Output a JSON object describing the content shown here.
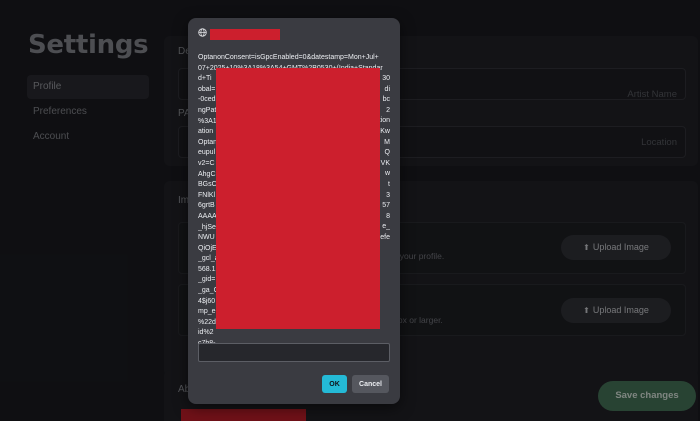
{
  "settings": {
    "title": "Settings",
    "nav": [
      "Profile",
      "Preferences",
      "Account"
    ]
  },
  "details_card": {
    "label": "De",
    "field1_placeholder": "Artist Name",
    "second_label": "PA",
    "field2_placeholder": "Location"
  },
  "images_card": {
    "label": "Im",
    "row1_hint": "ance your profile.",
    "row2_hint": "1200px or larger.",
    "upload_label": "Upload Image",
    "upload_icon": "upload-arrow-icon"
  },
  "about_card": {
    "label": "Ab"
  },
  "save_label": "Save changes",
  "colors": {
    "accent_ok": "#24bad6",
    "save": "#4a7a5e",
    "redaction": "#cc1f2d"
  },
  "modal": {
    "icon": "globe-icon",
    "lines": [
      "OptanonConsent=isGpcEnabled=0&datestamp=Mon+Jul+",
      "07+2025+10%3A18%3A54+GMT%2B0530+(India+Standar",
      "d+Ti",
      "obal=",
      "-0ced",
      "ngPat",
      "%3A1",
      "ation",
      "Optan",
      "eupul",
      "v2=C",
      "AhgC",
      "BGsC",
      "FNlKl",
      "6grtB",
      "AAAA",
      "_hjSe",
      "NWU",
      "QiOjE",
      "_gcl_a",
      "568.1",
      "_gid=",
      "_ga_C",
      "4$j60",
      "mp_e",
      "%22d",
      "id%2",
      "c7b8-",
      "rrer%22%3A%22%24direct%22%2C%22%24initial_referring"
    ],
    "right_fragments": [
      "30",
      "di",
      "bc",
      "2",
      "ocation",
      "Kw",
      "M",
      "Q",
      "VK",
      "w",
      "t",
      "3",
      "57",
      "8",
      "e_",
      "efe"
    ],
    "input_value": "",
    "ok_label": "OK",
    "cancel_label": "Cancel"
  }
}
